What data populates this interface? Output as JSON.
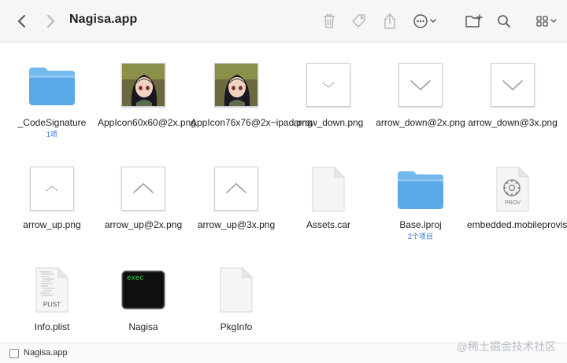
{
  "window": {
    "title": "Nagisa.app"
  },
  "toolbar": {
    "back_icon": "chevron-left-icon",
    "forward_icon": "chevron-right-icon",
    "actions": [
      "trash-icon",
      "tag-icon",
      "share-icon",
      "more-icon",
      "new-folder-icon",
      "search-icon",
      "view-grid-icon"
    ]
  },
  "files": [
    {
      "name": "_CodeSignature",
      "sub": "1项",
      "kind": "folder"
    },
    {
      "name": "AppIcon60x60@2x.png",
      "kind": "photo"
    },
    {
      "name": "AppIcon76x76@2x~ipad.png",
      "kind": "photo"
    },
    {
      "name": "arrow_down.png",
      "kind": "png-arrow-down-small"
    },
    {
      "name": "arrow_down@2x.png",
      "kind": "png-arrow-down"
    },
    {
      "name": "arrow_down@3x.png",
      "kind": "png-arrow-down"
    },
    {
      "name": "arrow_up.png",
      "kind": "png-arrow-up-small"
    },
    {
      "name": "arrow_up@2x.png",
      "kind": "png-arrow-up"
    },
    {
      "name": "arrow_up@3x.png",
      "kind": "png-arrow-up"
    },
    {
      "name": "Assets.car",
      "kind": "document"
    },
    {
      "name": "Base.lproj",
      "sub": "2个项目",
      "kind": "folder"
    },
    {
      "name": "embedded.mobileprovision",
      "kind": "provision",
      "badge": "PROV"
    },
    {
      "name": "Info.plist",
      "kind": "plist",
      "badge": "PLIST"
    },
    {
      "name": "Nagisa",
      "kind": "exec",
      "badge": "exec"
    },
    {
      "name": "PkgInfo",
      "kind": "document"
    }
  ],
  "statusbar": {
    "path": "Nagisa.app"
  },
  "watermark": "@稀土掘金技术社区",
  "colors": {
    "folder": "#5aa9e6",
    "folder_tab": "#74b9ee",
    "sub_text": "#2f6fd6"
  }
}
